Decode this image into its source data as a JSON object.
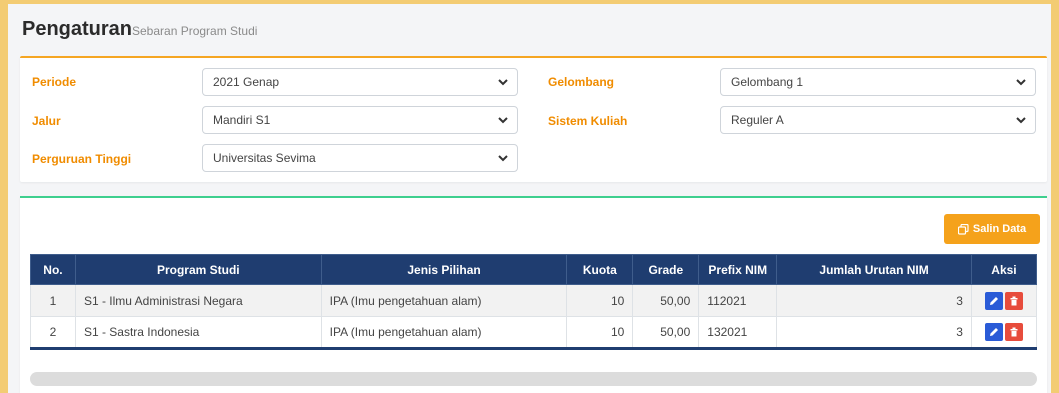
{
  "header": {
    "title": "Pengaturan",
    "subtitle": "Sebaran Program Studi"
  },
  "filters": {
    "periode": {
      "label": "Periode",
      "value": "2021 Genap"
    },
    "gelombang": {
      "label": "Gelombang",
      "value": "Gelombang 1"
    },
    "jalur": {
      "label": "Jalur",
      "value": "Mandiri S1"
    },
    "sistem_kuliah": {
      "label": "Sistem Kuliah",
      "value": "Reguler A"
    },
    "perguruan_tinggi": {
      "label": "Perguruan Tinggi",
      "value": "Universitas Sevima"
    }
  },
  "toolbar": {
    "copy_label": "Salin Data",
    "copy_icon": "copy-icon",
    "accent": "#f5a21b"
  },
  "table": {
    "columns": [
      "No.",
      "Program Studi",
      "Jenis Pilihan",
      "Kuota",
      "Grade",
      "Prefix NIM",
      "Jumlah Urutan NIM",
      "Aksi"
    ],
    "rows": [
      {
        "no": "1",
        "program": "S1 - Ilmu Administrasi Negara",
        "jenis": "IPA (Imu pengetahuan alam)",
        "kuota": "10",
        "grade": "50,00",
        "prefix": "112021",
        "jumlah": "3"
      },
      {
        "no": "2",
        "program": "S1 - Sastra Indonesia",
        "jenis": "IPA (Imu pengetahuan alam)",
        "kuota": "10",
        "grade": "50,00",
        "prefix": "132021",
        "jumlah": "3"
      }
    ],
    "actions": {
      "edit_icon": "pencil-icon",
      "delete_icon": "trash-icon"
    },
    "header_color": "#1f3d70"
  }
}
